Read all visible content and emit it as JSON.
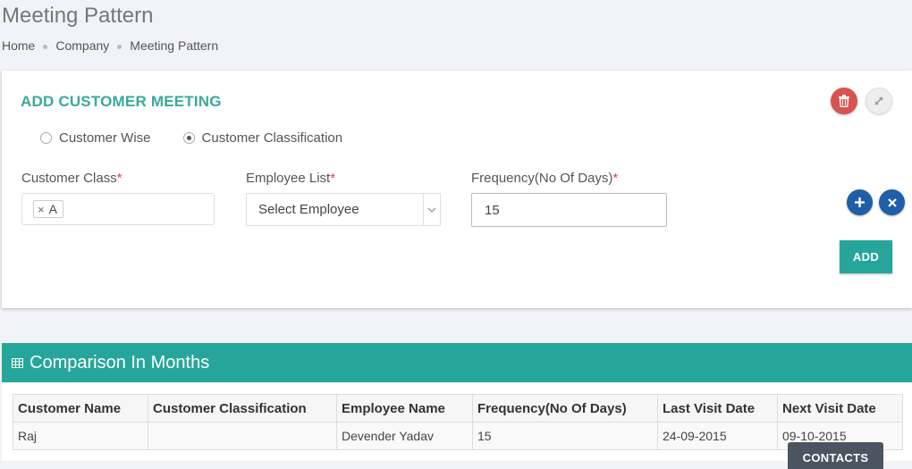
{
  "page": {
    "title": "Meeting Pattern",
    "breadcrumb": [
      "Home",
      "Company",
      "Meeting Pattern"
    ]
  },
  "form": {
    "title": "ADD CUSTOMER MEETING",
    "radio_options": [
      "Customer Wise",
      "Customer Classification"
    ],
    "selected_radio": "Customer Classification",
    "customer_class_label": "Customer Class",
    "customer_class_tag": "A",
    "employee_list_label": "Employee List",
    "employee_select_value": "Select Employee",
    "frequency_label": "Frequency(No Of Days)",
    "frequency_value": "15",
    "required_mark": "*",
    "add_button": "ADD"
  },
  "icons": {
    "delete": "trash-icon",
    "expand": "expand-icon",
    "add_row": "plus-icon",
    "remove_row": "close-icon",
    "section": "grid-icon",
    "select_caret": "chevron-down-icon"
  },
  "colors": {
    "accent": "#26a69a",
    "panel_title": "#3aa99b",
    "danger": "#d9534f",
    "circle_button": "#1f5ea8"
  },
  "section": {
    "title": "Comparison In Months"
  },
  "table": {
    "columns": [
      "Customer Name",
      "Customer Classification",
      "Employee Name",
      "Frequency(No Of Days)",
      "Last Visit Date",
      "Next Visit Date"
    ],
    "rows": [
      [
        "Raj",
        "",
        "Devender Yadav",
        "15",
        "24-09-2015",
        "09-10-2015"
      ]
    ]
  },
  "contacts_tab": "CONTACTS"
}
